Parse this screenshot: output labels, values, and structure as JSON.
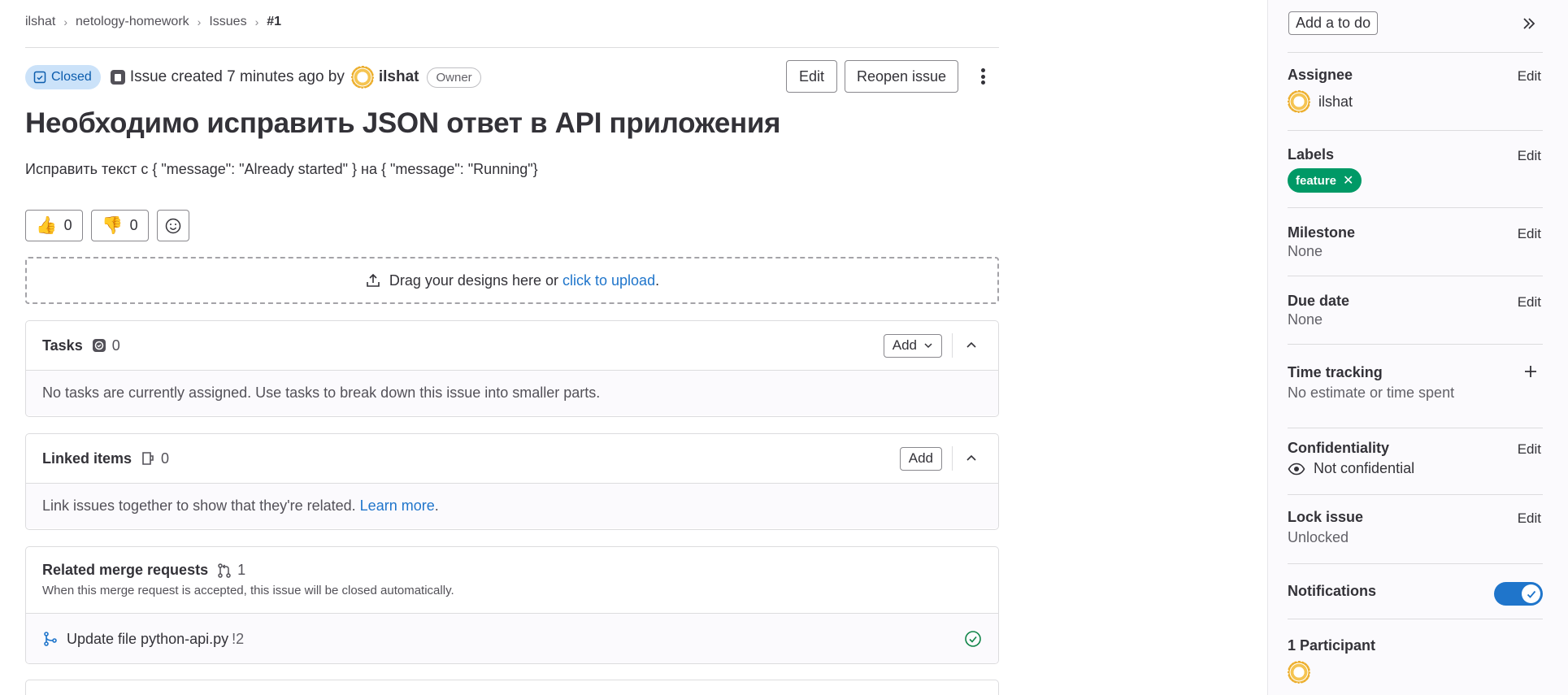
{
  "breadcrumb": [
    "ilshat",
    "netology-homework",
    "Issues",
    "#1"
  ],
  "issue": {
    "status": "Closed",
    "meta_text": "Issue created 7 minutes ago by",
    "author": "ilshat",
    "author_role": "Owner",
    "title": "Необходимо исправить JSON ответ в API приложения",
    "description": "Исправить текст с { \"message\": \"Already started\" } на { \"message\": \"Running\"}"
  },
  "actions": {
    "edit": "Edit",
    "reopen": "Reopen issue"
  },
  "awards": {
    "thumbsup_count": "0",
    "thumbsdown_count": "0"
  },
  "upload": {
    "text": "Drag your designs here or",
    "link": "click to upload",
    "suffix": "."
  },
  "tasks": {
    "title": "Tasks",
    "count": "0",
    "add_label": "Add",
    "empty": "No tasks are currently assigned. Use tasks to break down this issue into smaller parts."
  },
  "linked": {
    "title": "Linked items",
    "count": "0",
    "add_label": "Add",
    "empty": "Link issues together to show that they're related.",
    "learn_more": "Learn more",
    "suffix": "."
  },
  "merge_requests": {
    "title": "Related merge requests",
    "count": "1",
    "subtitle": "When this merge request is accepted, this issue will be closed automatically.",
    "items": [
      {
        "title": "Update file python-api.py",
        "ref": "!2"
      }
    ]
  },
  "sidebar": {
    "todo": "Add a to do",
    "assignee": {
      "label": "Assignee",
      "edit": "Edit",
      "value": "ilshat"
    },
    "labels": {
      "label": "Labels",
      "edit": "Edit",
      "items": [
        "feature"
      ]
    },
    "milestone": {
      "label": "Milestone",
      "edit": "Edit",
      "value": "None"
    },
    "due_date": {
      "label": "Due date",
      "edit": "Edit",
      "value": "None"
    },
    "time_tracking": {
      "label": "Time tracking",
      "value": "No estimate or time spent"
    },
    "confidentiality": {
      "label": "Confidentiality",
      "edit": "Edit",
      "value": "Not confidential"
    },
    "lock": {
      "label": "Lock issue",
      "edit": "Edit",
      "value": "Unlocked"
    },
    "notifications": {
      "label": "Notifications",
      "enabled": true
    },
    "participants": {
      "label": "1 Participant"
    }
  },
  "colors": {
    "accent_blue": "#1f75cb",
    "closed_badge_bg": "#cbe2f9",
    "label_green": "#009966",
    "success_green": "#108548"
  },
  "icons": [
    "chevron-right-icon",
    "closed-issue-icon",
    "issue-type-icon",
    "kebab-menu-icon",
    "thumbsup-icon",
    "thumbsdown-icon",
    "smiley-icon",
    "upload-icon",
    "task-icon",
    "chevron-down-icon",
    "chevron-up-icon",
    "link-icon",
    "merge-request-icon",
    "branch-icon",
    "check-circle-icon",
    "collapse-sidebar-icon",
    "eye-icon",
    "plus-icon",
    "check-icon"
  ]
}
